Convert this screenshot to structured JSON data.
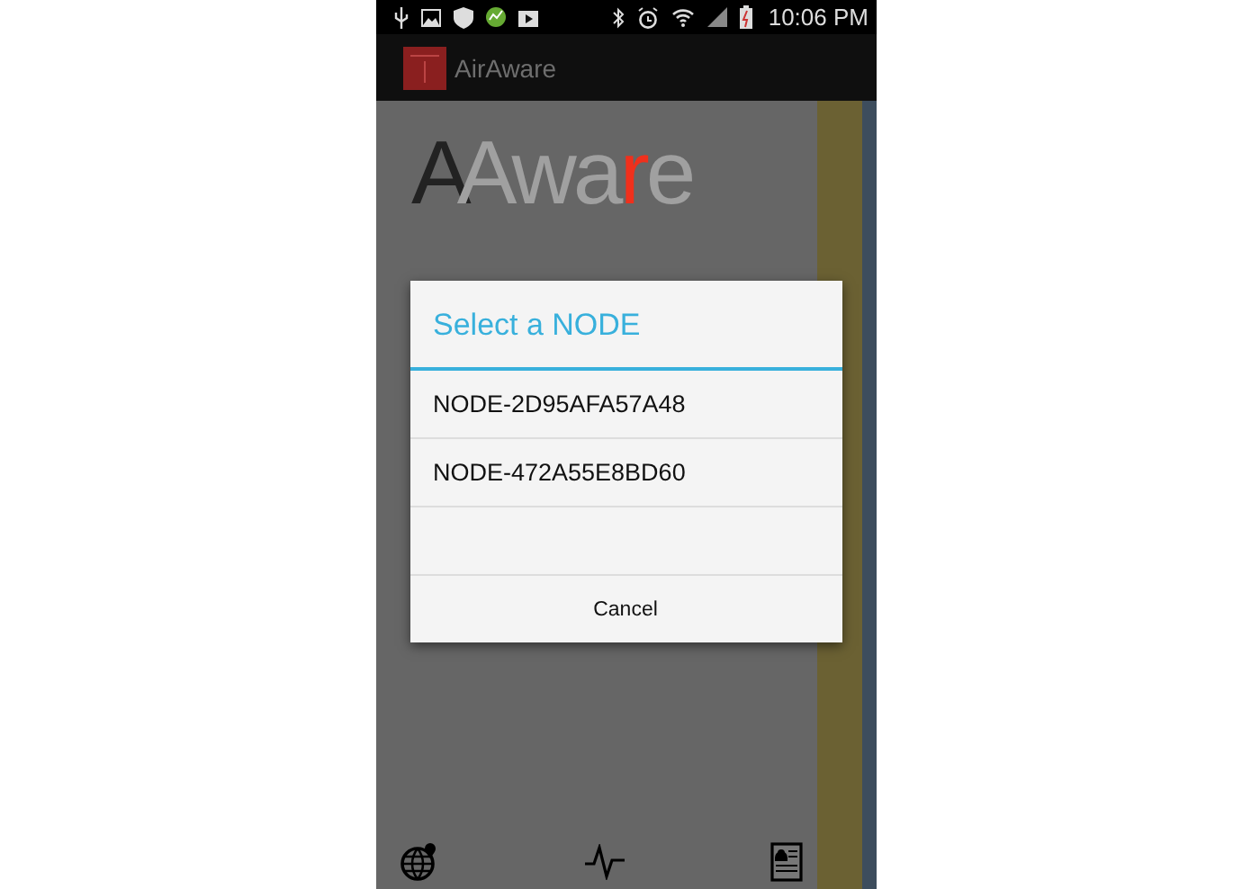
{
  "status_bar": {
    "time": "10:06 PM"
  },
  "action_bar": {
    "title": "AirAware"
  },
  "logo": {
    "mark": "A",
    "parts": [
      {
        "text": "Awa",
        "kind": "plain"
      },
      {
        "text": "r",
        "kind": "accent"
      },
      {
        "text": "e",
        "kind": "plain"
      }
    ]
  },
  "dialog": {
    "title": "Select a NODE",
    "items": [
      {
        "label": "NODE-2D95AFA57A48"
      },
      {
        "label": "NODE-472A55E8BD60"
      }
    ],
    "cancel": "Cancel"
  }
}
